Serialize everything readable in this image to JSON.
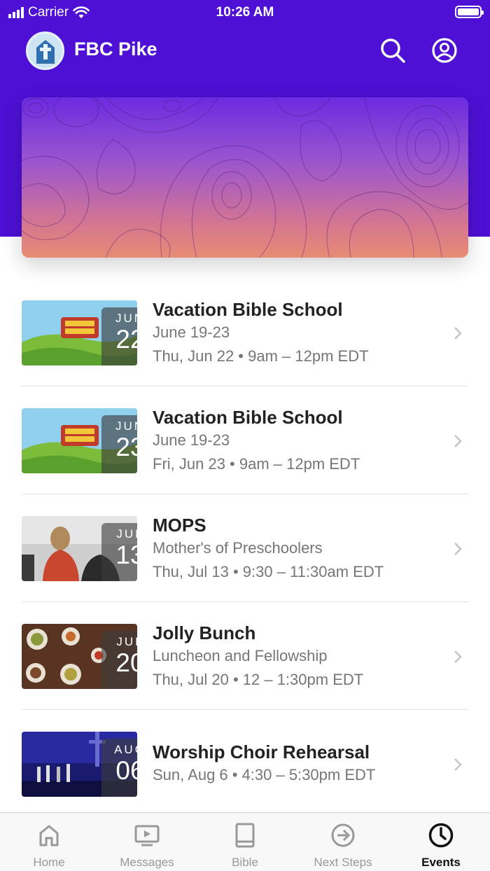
{
  "status_bar": {
    "carrier": "Carrier",
    "time": "10:26 AM"
  },
  "header": {
    "title": "FBC Pike",
    "search_icon": "search-icon",
    "profile_icon": "user-circle-icon"
  },
  "events": [
    {
      "month": "JUN",
      "day": "22",
      "title": "Vacation Bible School",
      "subtitle": "June 19-23",
      "time": "Thu, Jun 22 • 9am – 12pm EDT",
      "thumb": "vbs"
    },
    {
      "month": "JUN",
      "day": "23",
      "title": "Vacation Bible School",
      "subtitle": "June 19-23",
      "time": "Fri, Jun 23 • 9am – 12pm EDT",
      "thumb": "vbs"
    },
    {
      "month": "JUL",
      "day": "13",
      "title": "MOPS",
      "subtitle": "Mother's of Preschoolers",
      "time": "Thu, Jul 13 • 9:30 – 11:30am EDT",
      "thumb": "mops"
    },
    {
      "month": "JUL",
      "day": "20",
      "title": "Jolly Bunch",
      "subtitle": "Luncheon and Fellowship",
      "time": "Thu, Jul 20 • 12 – 1:30pm EDT",
      "thumb": "food"
    },
    {
      "month": "AUG",
      "day": "06",
      "title": "Worship Choir Rehearsal",
      "subtitle": "",
      "time": "Sun, Aug 6 • 4:30 – 5:30pm EDT",
      "thumb": "stage"
    }
  ],
  "tabs": [
    {
      "label": "Home",
      "icon": "home-icon",
      "active": false
    },
    {
      "label": "Messages",
      "icon": "video-screen-icon",
      "active": false
    },
    {
      "label": "Bible",
      "icon": "book-icon",
      "active": false
    },
    {
      "label": "Next Steps",
      "icon": "arrow-circle-icon",
      "active": false
    },
    {
      "label": "Events",
      "icon": "clock-icon",
      "active": true
    }
  ],
  "colors": {
    "brand": "#4d10d4",
    "text_primary": "#222222",
    "text_secondary": "#767676",
    "tab_inactive": "#999999"
  }
}
